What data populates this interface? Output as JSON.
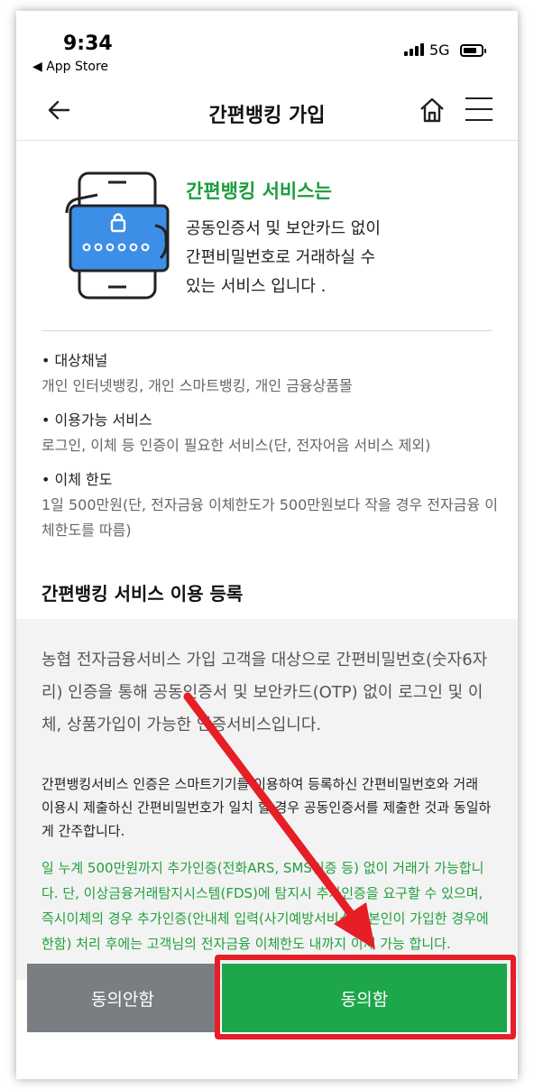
{
  "status_bar": {
    "time": "9:34",
    "back_app": "◀ App Store",
    "network": "5G"
  },
  "nav": {
    "title": "간편뱅킹 가입",
    "back_icon": "arrow-left-icon",
    "home_icon": "home-icon",
    "menu_icon": "hamburger-menu-icon"
  },
  "intro": {
    "heading": "간편뱅킹 서비스는",
    "line1": "공동인증서 및 보안카드 없이",
    "line2": "간편비밀번호로 거래하실 수",
    "line3": "있는 서비스 입니다 .",
    "illustration_icon": "phone-with-lock-card-icon"
  },
  "info": {
    "items": [
      {
        "label": "• 대상채널",
        "desc": "개인 인터넷뱅킹, 개인 스마트뱅킹, 개인 금융상품몰"
      },
      {
        "label": "• 이용가능 서비스",
        "desc": "로그인, 이체 등 인증이 필요한 서비스(단, 전자어음 서비스 제외)"
      },
      {
        "label": "• 이체 한도",
        "desc": "1일 500만원(단, 전자금융 이체한도가 500만원보다 작을 경우 전자금융 이체한도를 따름)"
      }
    ]
  },
  "registration": {
    "title": "간편뱅킹 서비스 이용 등록",
    "summary": "농협 전자금융서비스 가입 고객을 대상으로 간편비밀번호(숫자6자리) 인증을 통해 공동인증서 및 보안카드(OTP) 없이 로그인 및 이체, 상품가입이 가능한 인증서비스입니다.",
    "detail": "간편뱅킹서비스 인증은 스마트기기를 이용하여 등록하신 간편비밀번호와 거래 이용시 제출하신 간편비밀번호가 일치 할 경우 공동인증서를 제출한 것과 동일하게 간주합니다.",
    "notice": "일 누계 500만원까지 추가인증(전화ARS, SMS인증 등) 없이 거래가 가능합니다. 단, 이상금융거래탐지시스템(FDS)에 탐지시 추가인증을 요구할 수 있으며, 즉시이체의 경우 추가인증(안내체 입력(사기예방서비스는 본인이 가입한 경우에 한함) 처리 후에는 고객님의 전자금융 이체한도 내까지 이체 가능 합니다."
  },
  "buttons": {
    "cancel": "동의안함",
    "agree": "동의함"
  },
  "colors": {
    "accent_green": "#1ea64a",
    "heading_green": "#1a9e3f",
    "cancel_gray": "#7a7e83",
    "highlight_red": "#e61e27"
  }
}
